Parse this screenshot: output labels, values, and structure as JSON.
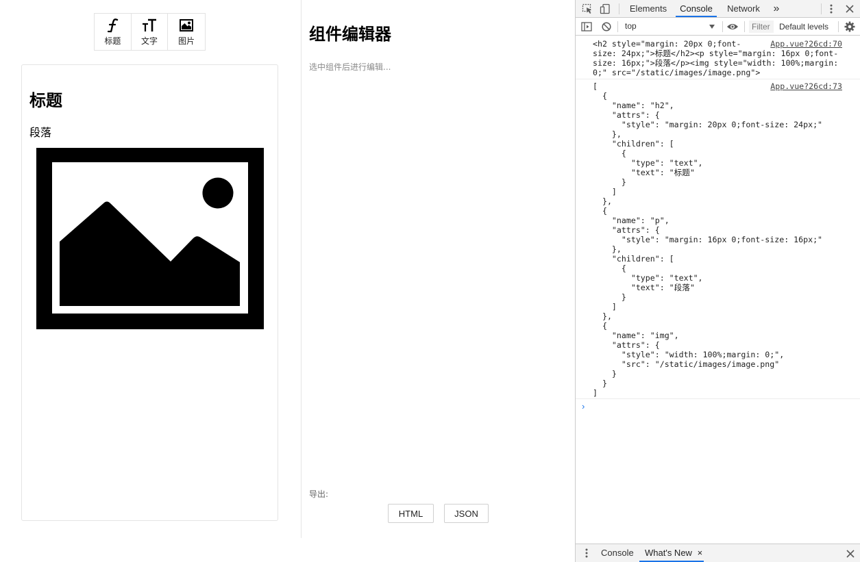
{
  "toolbar": {
    "items": [
      {
        "label": "标题",
        "icon": "italic-f-icon"
      },
      {
        "label": "文字",
        "icon": "text-size-icon"
      },
      {
        "label": "图片",
        "icon": "image-icon"
      }
    ]
  },
  "preview": {
    "heading": "标题",
    "paragraph": "段落"
  },
  "editor": {
    "title": "组件编辑器",
    "hint": "选中组件后进行编辑...",
    "export_label": "导出:",
    "html_button": "HTML",
    "json_button": "JSON"
  },
  "devtools": {
    "tabs": [
      "Elements",
      "Console",
      "Network"
    ],
    "active_tab": "Console",
    "more": "»",
    "context": "top",
    "filter_placeholder": "Filter",
    "levels": "Default levels",
    "logs": [
      {
        "source": "App.vue?26cd:70",
        "text": "<h2 style=\"margin: 20px 0;font-\nsize: 24px;\">标题</h2><p style=\"margin: 16px 0;font-\nsize: 16px;\">段落</p><img style=\"width: 100%;margin:\n0;\" src=\"/static/images/image.png\">"
      },
      {
        "source": "App.vue?26cd:73",
        "text": "[\n  {\n    \"name\": \"h2\",\n    \"attrs\": {\n      \"style\": \"margin: 20px 0;font-size: 24px;\"\n    },\n    \"children\": [\n      {\n        \"type\": \"text\",\n        \"text\": \"标题\"\n      }\n    ]\n  },\n  {\n    \"name\": \"p\",\n    \"attrs\": {\n      \"style\": \"margin: 16px 0;font-size: 16px;\"\n    },\n    \"children\": [\n      {\n        \"type\": \"text\",\n        \"text\": \"段落\"\n      }\n    ]\n  },\n  {\n    \"name\": \"img\",\n    \"attrs\": {\n      \"style\": \"width: 100%;margin: 0;\",\n      \"src\": \"/static/images/image.png\"\n    }\n  }\n]"
      }
    ],
    "prompt": "›",
    "drawer_tabs": [
      "Console",
      "What's New"
    ],
    "drawer_close": "×",
    "accent": "#1a73e8"
  }
}
